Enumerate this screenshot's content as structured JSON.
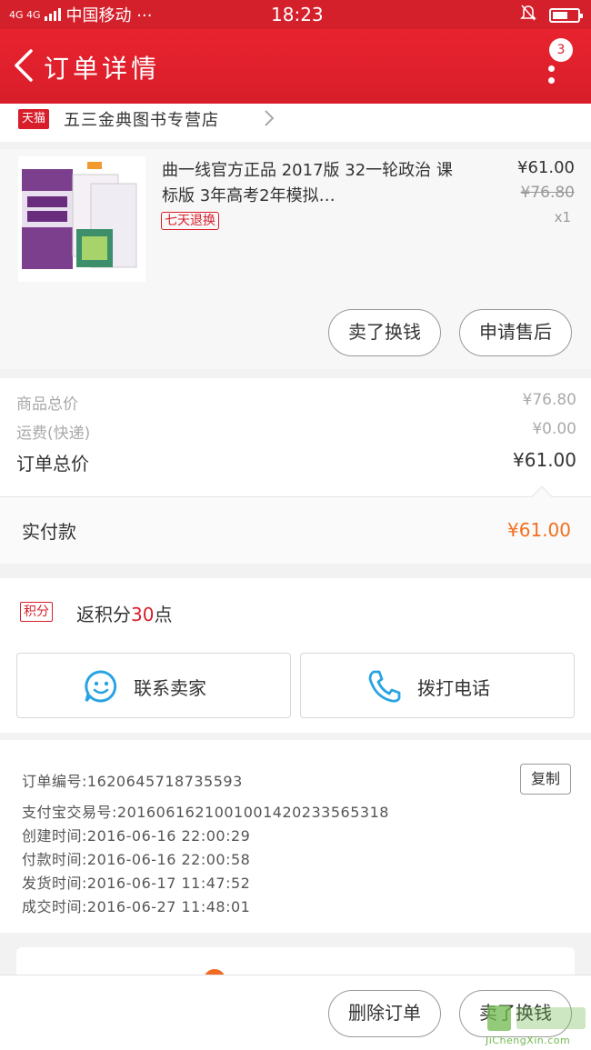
{
  "status_bar": {
    "signal": "4G 4G",
    "carrier": "中国移动 ···",
    "time": "18:23"
  },
  "header": {
    "title": "订单详情",
    "message_count": "3"
  },
  "shop": {
    "tag": "天猫",
    "name": "五三金典图书专营店"
  },
  "product": {
    "title": "曲一线官方正品 2017版 32一轮政治 课标版 3年高考2年模拟…",
    "return_tag": "七天退换",
    "price": "¥61.00",
    "original_price": "¥76.80",
    "quantity": "x1"
  },
  "product_actions": {
    "sell_label": "卖了换钱",
    "after_sale_label": "申请售后"
  },
  "summary": {
    "goods_total_label": "商品总价",
    "goods_total_value": "¥76.80",
    "shipping_label": "运费(快递)",
    "shipping_value": "¥0.00",
    "order_total_label": "订单总价",
    "order_total_value": "¥61.00",
    "paid_label": "实付款",
    "paid_value": "¥61.00"
  },
  "points": {
    "tag": "积分",
    "text_before": "返积分",
    "count": "30",
    "text_after": "点"
  },
  "contact": {
    "seller_label": "联系卖家",
    "call_label": "拨打电话"
  },
  "order_info": {
    "order_no": "订单编号:1620645718735593",
    "copy_label": "复制",
    "alipay_no": "支付宝交易号:2016061621001001420233565318",
    "created": "创建时间:2016-06-16 22:00:29",
    "paid": "付款时间:2016-06-16 22:00:58",
    "shipped": "发货时间:2016-06-17 11:47:52",
    "completed": "成交时间:2016-06-27 11:48:01"
  },
  "bottom_bar": {
    "delete_label": "删除订单",
    "sell_label": "卖了换钱"
  },
  "watermark": {
    "text": "JiChengXin.com"
  },
  "colors": {
    "brand_red": "#d81e2a",
    "accent_orange": "#f07020",
    "icon_blue": "#29a3e3"
  }
}
